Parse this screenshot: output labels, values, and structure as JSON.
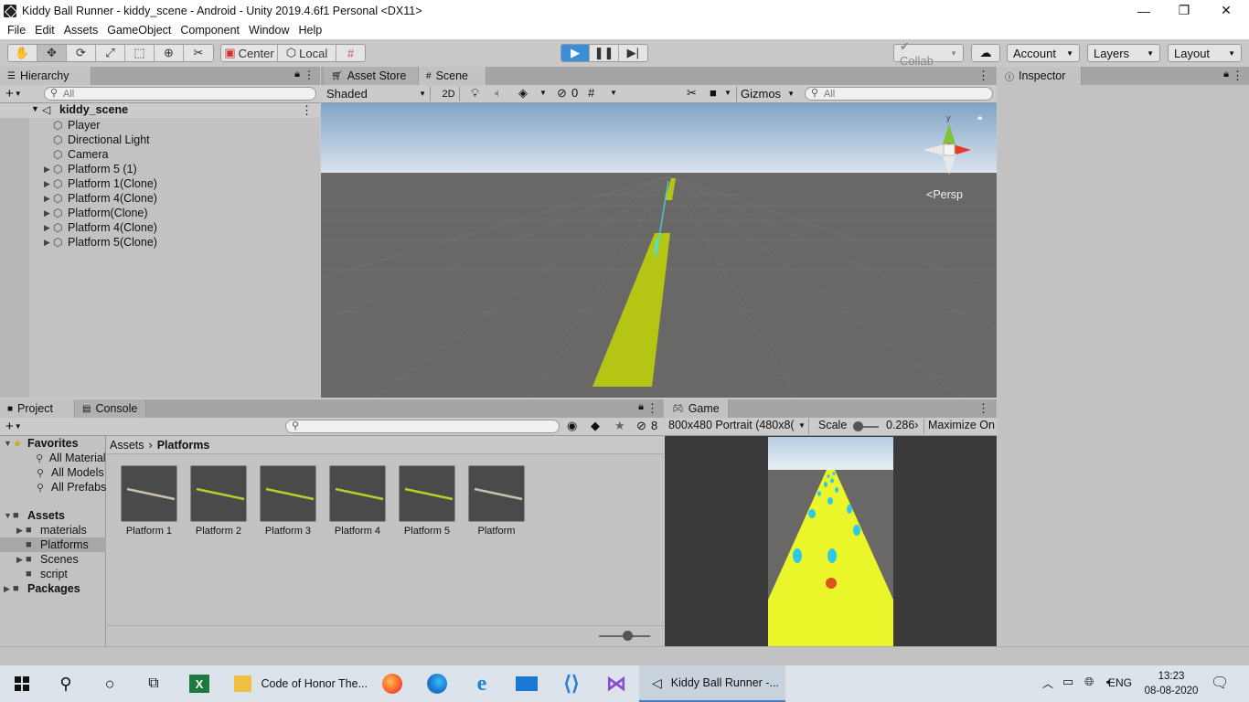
{
  "window": {
    "title": "Kiddy Ball Runner - kiddy_scene - Android - Unity 2019.4.6f1 Personal <DX11>",
    "minimize": "—",
    "maximize": "❐",
    "close": "✕"
  },
  "menu": [
    "File",
    "Edit",
    "Assets",
    "GameObject",
    "Component",
    "Window",
    "Help"
  ],
  "toolbar": {
    "pivot_label": "Center",
    "space_label": "Local",
    "collab_label": "Collab",
    "account_label": "Account",
    "layers_label": "Layers",
    "layout_label": "Layout"
  },
  "hierarchy": {
    "tab_label": "Hierarchy",
    "search_placeholder": "All",
    "scene_name": "kiddy_scene",
    "items": [
      {
        "name": "Player",
        "expandable": false
      },
      {
        "name": "Directional Light",
        "expandable": false
      },
      {
        "name": "Camera",
        "expandable": false
      },
      {
        "name": "Platform 5 (1)",
        "expandable": true
      },
      {
        "name": "Platform 1(Clone)",
        "expandable": true
      },
      {
        "name": "Platform 4(Clone)",
        "expandable": true
      },
      {
        "name": "Platform(Clone)",
        "expandable": true
      },
      {
        "name": "Platform 4(Clone)",
        "expandable": true
      },
      {
        "name": "Platform 5(Clone)",
        "expandable": true
      }
    ]
  },
  "scene": {
    "tab_asset_store": "Asset Store",
    "tab_scene": "Scene",
    "shading_mode": "Shaded",
    "mode_2d": "2D",
    "hidden_count": "0",
    "gizmos_label": "Gizmos",
    "search_placeholder": "All",
    "projection_label": "Persp"
  },
  "inspector": {
    "tab_label": "Inspector"
  },
  "project": {
    "tab_project": "Project",
    "tab_console": "Console",
    "hidden_count": "8",
    "breadcrumb_root": "Assets",
    "breadcrumb_current": "Platforms",
    "favorites_label": "Favorites",
    "favorites": [
      "All Materials",
      "All Models",
      "All Prefabs"
    ],
    "assets_label": "Assets",
    "asset_folders": [
      {
        "name": "materials",
        "expandable": true
      },
      {
        "name": "Platforms",
        "expandable": false,
        "selected": true
      },
      {
        "name": "Scenes",
        "expandable": true
      },
      {
        "name": "script",
        "expandable": false
      }
    ],
    "packages_label": "Packages",
    "asset_items": [
      {
        "name": "Platform 1",
        "color": "#c9c0ad"
      },
      {
        "name": "Platform 2",
        "color": "#b9cc2a"
      },
      {
        "name": "Platform 3",
        "color": "#b9cc2a"
      },
      {
        "name": "Platform 4",
        "color": "#b9cc2a"
      },
      {
        "name": "Platform 5",
        "color": "#b9cc2a"
      },
      {
        "name": "Platform",
        "color": "#c9c0ad"
      }
    ]
  },
  "game": {
    "tab_label": "Game",
    "resolution": "800x480 Portrait (480x8(",
    "scale_label": "Scale",
    "scale_value": "0.286›",
    "maximize_label": "Maximize On"
  },
  "taskbar": {
    "apps": [
      "Code of Honor The...",
      "Kiddy Ball Runner -..."
    ],
    "language": "ENG",
    "time": "13:23",
    "date": "08-08-2020"
  },
  "colors": {
    "platform_yellow": "#b5c514",
    "game_yellow": "#eaf52a",
    "play_blue": "#3d8ed8"
  }
}
